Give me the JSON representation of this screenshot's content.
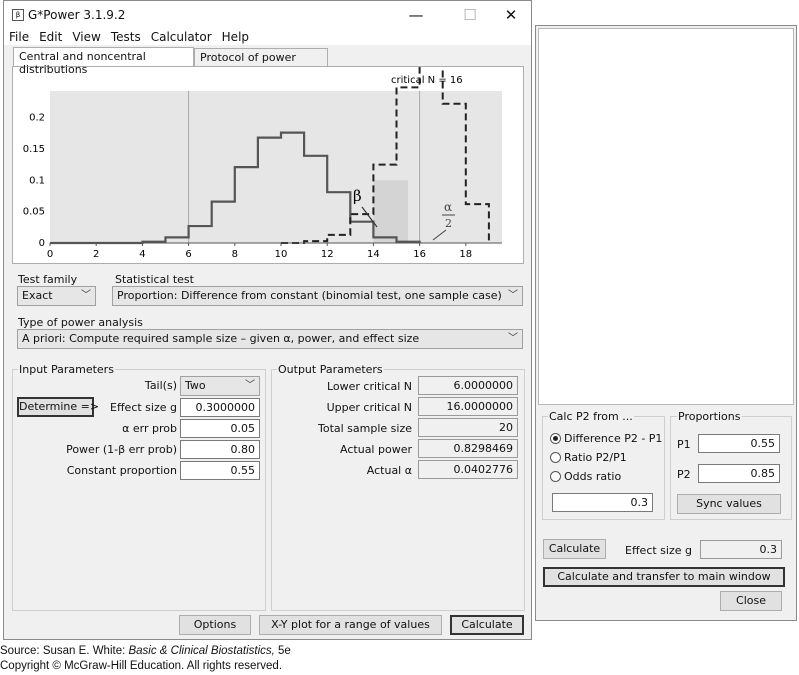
{
  "window": {
    "title": "G*Power 3.1.9.2",
    "icon": "gpower-app-icon",
    "controls": {
      "minimize": "—",
      "maximize": "☐",
      "close": "✕"
    }
  },
  "menu": [
    "File",
    "Edit",
    "View",
    "Tests",
    "Calculator",
    "Help"
  ],
  "tabs": [
    "Central and noncentral distributions",
    "Protocol of power analyses"
  ],
  "plot": {
    "critical_label": "critical N = 16",
    "beta_label": "β",
    "alpha_num": "α",
    "alpha_den": "2",
    "y_ticks": [
      "0.2",
      "0.15",
      "0.1",
      "0.05",
      "0"
    ],
    "x_ticks": [
      "0",
      "2",
      "4",
      "6",
      "8",
      "10",
      "12",
      "14",
      "16",
      "18"
    ],
    "null_points": [
      [
        4,
        0.002
      ],
      [
        5,
        0.009
      ],
      [
        6,
        0.027
      ],
      [
        7,
        0.066
      ],
      [
        8,
        0.121
      ],
      [
        9,
        0.168
      ],
      [
        10,
        0.176
      ],
      [
        11,
        0.139
      ],
      [
        12,
        0.081
      ],
      [
        13,
        0.034
      ],
      [
        14,
        0.009
      ],
      [
        15,
        0.002
      ],
      [
        16,
        0.0
      ]
    ],
    "alt_points": [
      [
        11,
        0.003
      ],
      [
        12,
        0.013
      ],
      [
        13,
        0.046
      ],
      [
        14,
        0.125
      ],
      [
        15,
        0.248
      ],
      [
        16,
        0.333
      ],
      [
        17,
        0.222
      ],
      [
        18,
        0.062
      ],
      [
        19,
        0.0
      ]
    ]
  },
  "test_family": {
    "label": "Test family",
    "value": "Exact"
  },
  "statistical_test": {
    "label": "Statistical test",
    "value": "Proportion: Difference from constant (binomial test, one sample case)"
  },
  "power_analysis": {
    "label": "Type of power analysis",
    "value": "A priori: Compute required sample size – given α, power, and effect size"
  },
  "input": {
    "title": "Input Parameters",
    "determine": "Determine =>",
    "tails_label": "Tail(s)",
    "tails_value": "Two",
    "effect_label": "Effect size g",
    "effect_value": "0.3000000",
    "alpha_label": "α err prob",
    "alpha_value": "0.05",
    "power_label": "Power (1-β err prob)",
    "power_value": "0.80",
    "const_label": "Constant proportion",
    "const_value": "0.55"
  },
  "output": {
    "title": "Output Parameters",
    "lower_label": "Lower critical N",
    "lower_value": "6.0000000",
    "upper_label": "Upper critical N",
    "upper_value": "16.0000000",
    "total_label": "Total sample size",
    "total_value": "20",
    "power_label": "Actual power",
    "power_value": "0.8298469",
    "alpha_label": "Actual α",
    "alpha_value": "0.0402776"
  },
  "bottom_buttons": {
    "options": "Options",
    "xy_plot": "X-Y plot for a range of values",
    "calculate": "Calculate"
  },
  "calc_p2": {
    "title": "Calc P2 from ...",
    "opt1": "Difference P2 - P1",
    "opt2": "Ratio P2/P1",
    "opt3": "Odds ratio",
    "value": "0.3"
  },
  "proportions": {
    "title": "Proportions",
    "p1_label": "P1",
    "p1_value": "0.55",
    "p2_label": "P2",
    "p2_value": "0.85",
    "sync": "Sync values"
  },
  "side": {
    "calculate": "Calculate",
    "effect_label": "Effect size g",
    "effect_value": "0.3",
    "transfer": "Calculate and transfer to main window",
    "close": "Close"
  },
  "caption": {
    "source_prefix": "Source: Susan E. White: ",
    "source_title": "Basic & Clinical Biostatistics,",
    "source_suffix": " 5e",
    "copyright": "Copyright © McGraw-Hill Education. All rights reserved."
  }
}
